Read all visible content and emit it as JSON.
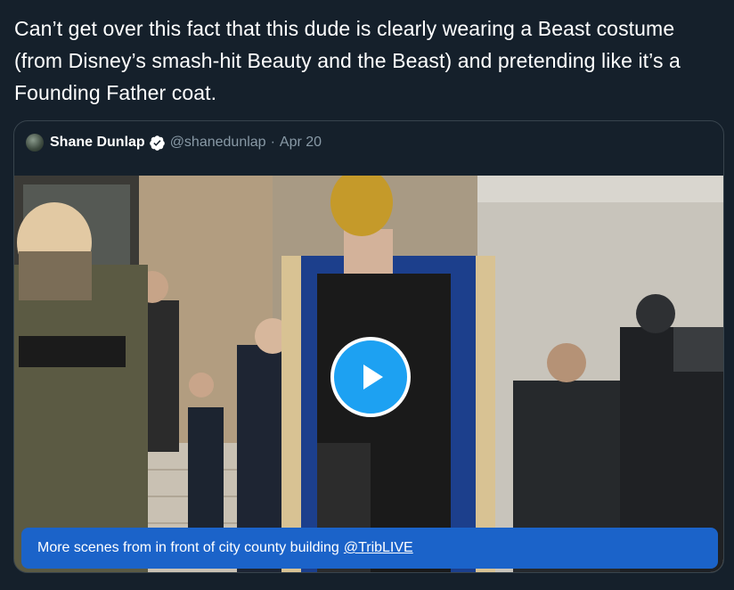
{
  "tweet": {
    "text": "Can’t get over this fact that this dude is clearly wearing a Beast costume (from Disney’s smash-hit Beauty and the Beast) and pretending like it’s a Founding Father coat."
  },
  "quoted_tweet": {
    "author_name": "Shane Dunlap",
    "handle": "@shanedunlap",
    "separator": "·",
    "date": "Apr 20",
    "verified": true,
    "media": {
      "type": "video",
      "play_icon": "play-icon",
      "caption_text": "More scenes from in front of city county building",
      "caption_link": "@TribLIVE"
    }
  },
  "colors": {
    "background": "#15202b",
    "border": "#38444d",
    "text_primary": "#ffffff",
    "text_secondary": "#8899a6",
    "accent": "#1da1f2",
    "caption_bg": "#1b63c9"
  }
}
